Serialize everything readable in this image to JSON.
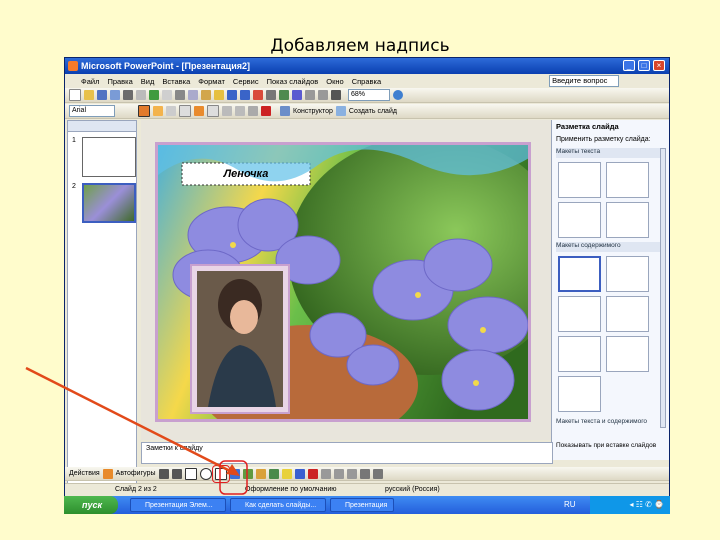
{
  "heading": "Добавляем надпись",
  "window": {
    "title": "Microsoft PowerPoint - [Презентация2]",
    "min": "_",
    "max": "□",
    "close": "×"
  },
  "menu": [
    "Файл",
    "Правка",
    "Вид",
    "Вставка",
    "Формат",
    "Сервис",
    "Показ слайдов",
    "Окно",
    "Справка"
  ],
  "help_field": "Введите вопрос",
  "zoom": "68%",
  "font_name": "Arial",
  "toolbar2": {
    "designer": "Конструктор",
    "new_slide": "Создать слайд"
  },
  "slide_label": "Леночка",
  "slide_thumbs": [
    "1",
    "2"
  ],
  "taskpane": {
    "title": "Разметка слайда",
    "apply": "Применить разметку слайда:",
    "text_layouts": "Макеты текста",
    "content_layouts": "Макеты содержимого",
    "text_content_layouts": "Макеты текста и содержимого",
    "show_on_insert": "Показывать при вставке слайдов"
  },
  "notes_placeholder": "Заметки к слайду",
  "drawing_toolbar": {
    "actions": "Действия",
    "autoshapes": "Автофигуры"
  },
  "status": {
    "slide": "Слайд 2 из 2",
    "design": "Оформление по умолчанию",
    "lang": "русский (Россия)"
  },
  "taskbar": {
    "start": "пуск",
    "items": [
      "Презентация Элем...",
      "Как сделать слайды...",
      "Презентация"
    ],
    "lang": "RU",
    "clock": "◂ ☷ ✆ ⌚"
  },
  "colors": {
    "arrow": "#e24a1a",
    "highlight": "#e02020"
  }
}
